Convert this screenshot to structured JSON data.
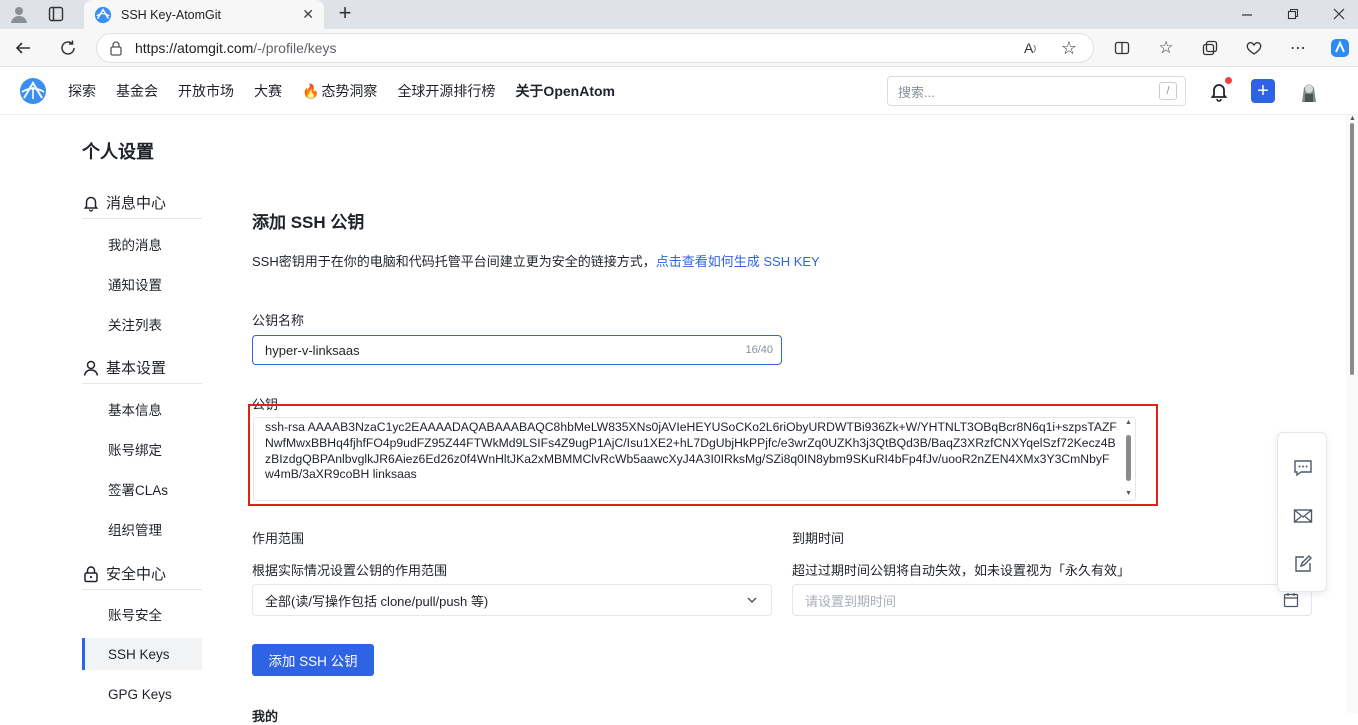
{
  "browser": {
    "tab_title": "SSH Key-AtomGit",
    "url_host": "https://atomgit.com",
    "url_path": "/-/profile/keys"
  },
  "site": {
    "nav": [
      "探索",
      "基金会",
      "开放市场",
      "大赛",
      "态势洞察",
      "全球开源排行榜",
      "关于OpenAtom"
    ],
    "search_placeholder": "搜索...",
    "search_shortcut": "/"
  },
  "sidebar": {
    "title": "个人设置",
    "sections": [
      {
        "label": "消息中心",
        "icon": "bell-icon",
        "items": [
          "我的消息",
          "通知设置",
          "关注列表"
        ]
      },
      {
        "label": "基本设置",
        "icon": "user-icon",
        "items": [
          "基本信息",
          "账号绑定",
          "签署CLAs",
          "组织管理"
        ]
      },
      {
        "label": "安全中心",
        "icon": "lock-icon",
        "items": [
          "账号安全",
          "SSH Keys",
          "GPG Keys"
        ]
      }
    ],
    "active_item": "SSH Keys"
  },
  "form": {
    "heading": "添加 SSH 公钥",
    "description": "SSH密钥用于在你的电脑和代码托管平台间建立更为安全的链接方式，",
    "description_link": "点击查看如何生成 SSH KEY",
    "name_label": "公钥名称",
    "name_value": "hyper-v-linksaas",
    "name_count": "16/40",
    "key_label": "公钥",
    "key_value": "ssh-rsa AAAAB3NzaC1yc2EAAAADAQABAAABAQC8hbMeLW835XNs0jAVIeHEYUSoCKo2L6riObyURDWTBi936Zk+W/YHTNLT3OBqBcr8N6q1i+szpsTAZFNwfMwxBBHq4fjhfFO4p9udFZ95Z44FTWkMd9LSIFs4Z9ugP1AjC/Isu1XE2+hL7DgUbjHkPPjfc/e3wrZq0UZKh3j3QtBQd3B/BaqZ3XRzfCNXYqelSzf72Kecz4BzBIzdgQBPAnlbvglkJR6Aiez6Ed26z0f4WnHltJKa2xMBMMClvRcWb5aawcXyJ4A3I0IRksMg/SZi8q0IN8ybm9SKuRI4bFp4fJv/uooR2nZEN4XMx3Y3CmNbyFw4mB/3aXR9coBH linksaas",
    "scope_label": "作用范围",
    "scope_hint": "根据实际情况设置公钥的作用范围",
    "scope_value": "全部(读/写操作包括 clone/pull/push 等)",
    "expire_label": "到期时间",
    "expire_hint": "超过过期时间公钥将自动失效，如未设置视为「永久有效」",
    "expire_placeholder": "请设置到期时间",
    "submit": "添加 SSH 公钥",
    "next_section_fragment": "我的"
  },
  "colors": {
    "accent": "#2e63e6",
    "highlight_border": "#e0201b"
  }
}
